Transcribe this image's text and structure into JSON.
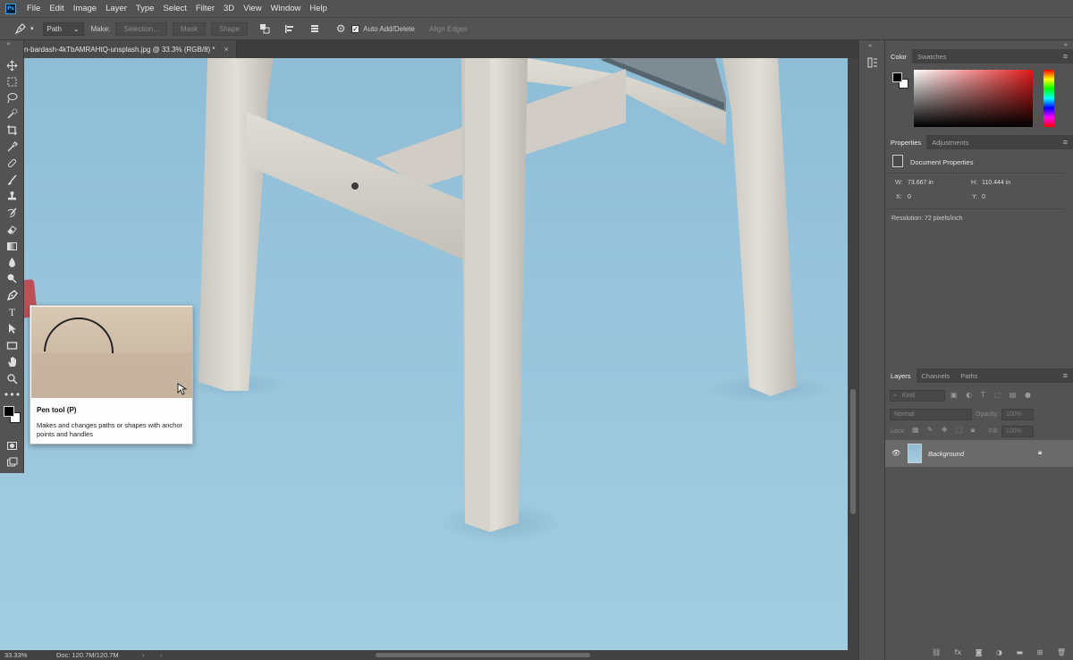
{
  "app": {
    "logo_text": "Ps"
  },
  "menu": [
    "File",
    "Edit",
    "Image",
    "Layer",
    "Type",
    "Select",
    "Filter",
    "3D",
    "View",
    "Window",
    "Help"
  ],
  "options": {
    "mode_select": "Path",
    "make_label": "Make:",
    "selection_btn": "Selection...",
    "mask_btn": "Mask",
    "shape_btn": "Shape",
    "auto_add_delete_label": "Auto Add/Delete",
    "auto_add_delete_checked": true,
    "align_edges_label": "Align Edges"
  },
  "document": {
    "tab_title": "n-bardash-4kTbAMRAHtQ-unsplash.jpg @ 33.3% (RGB/8) *",
    "close_glyph": "×"
  },
  "status": {
    "zoom": "33.33%",
    "doc_info": "Doc: 120.7M/120.7M",
    "arrow": "›"
  },
  "tooltip": {
    "title": "Pen tool (P)",
    "description": "Makes and changes paths or shapes with anchor points and handles"
  },
  "panels": {
    "color": {
      "tabs": [
        "Color",
        "Swatches"
      ],
      "foreground": "#000000",
      "background": "#ffffff"
    },
    "properties": {
      "tabs": [
        "Properties",
        "Adjustments"
      ],
      "section": "Document Properties",
      "w_label": "W:",
      "w_value": "73.667 in",
      "h_label": "H:",
      "h_value": "110.444 in",
      "x_label": "X:",
      "x_value": "0",
      "y_label": "Y:",
      "y_value": "0",
      "resolution": "Resolution: 72 pixels/inch"
    },
    "layers": {
      "tabs": [
        "Layers",
        "Channels",
        "Paths"
      ],
      "kind_placeholder": "Kind",
      "blend_mode": "Normal",
      "opacity_label": "Opacity:",
      "opacity_value": "100%",
      "lock_label": "Lock:",
      "fill_label": "Fill:",
      "fill_value": "100%",
      "layer_name": "Background"
    }
  },
  "colors": {
    "chrome": "#535353",
    "dark_chrome": "#424242",
    "canvas_blue": "#98c5dc",
    "highlight_red": "#c53a40"
  }
}
